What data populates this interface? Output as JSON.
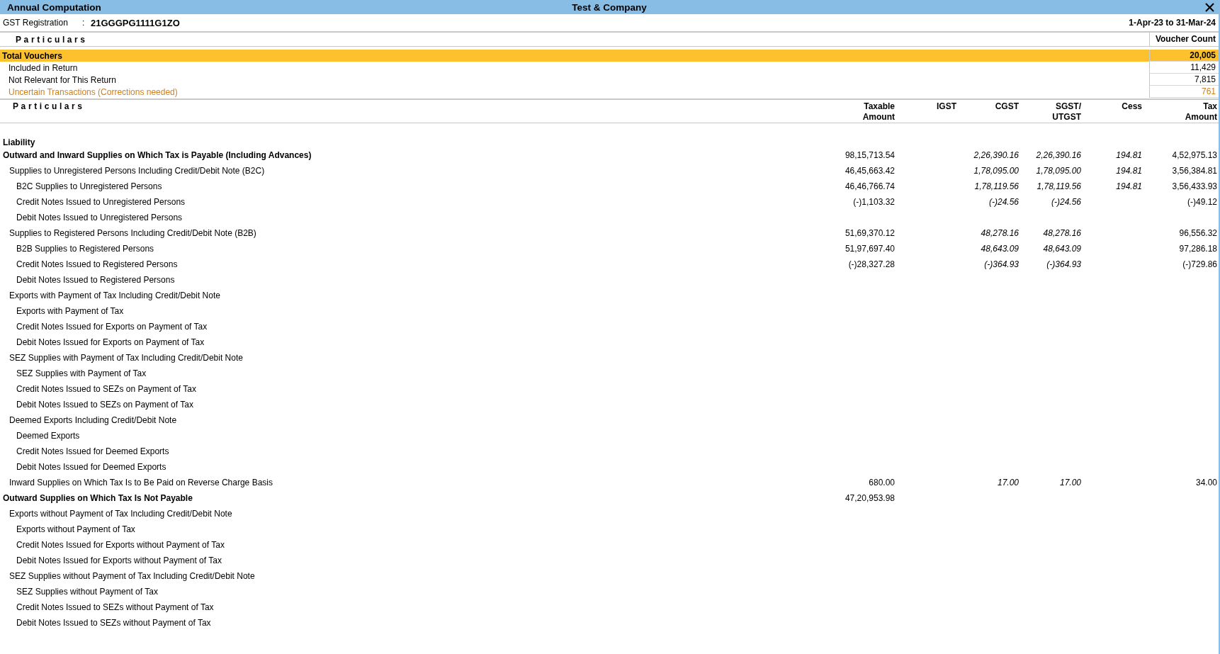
{
  "window": {
    "title": "Annual Computation",
    "company": "Test & Company"
  },
  "registration": {
    "label": "GST Registration",
    "separator": ":",
    "value": "21GGGPG1111G1ZO",
    "period": "1-Apr-23 to 31-Mar-24"
  },
  "voucher_summary": {
    "columns": [
      "Particulars",
      "Voucher Count"
    ],
    "rows": [
      {
        "label": "Total Vouchers",
        "count": "20,005",
        "kind": "total"
      },
      {
        "label": "Included in Return",
        "count": "11,429",
        "kind": "normal"
      },
      {
        "label": "Not Relevant for This Return",
        "count": "7,815",
        "kind": "normal"
      },
      {
        "label": "Uncertain Transactions (Corrections needed)",
        "count": "761",
        "kind": "uncertain"
      }
    ]
  },
  "table": {
    "columns": [
      "Particulars",
      "Taxable Amount",
      "IGST",
      "CGST",
      "SGST/ UTGST",
      "Cess",
      "Tax Amount"
    ],
    "heading": "Liability",
    "rows": [
      {
        "label": "Outward and Inward Supplies on Which Tax is Payable (Including Advances)",
        "taxable": "98,15,713.54",
        "cgst": "2,26,390.16",
        "sgst": "2,26,390.16",
        "cess": "194.81",
        "tax": "4,52,975.13",
        "children": [
          {
            "label": "Supplies to Unregistered Persons Including Credit/Debit Note (B2C)",
            "taxable": "46,45,663.42",
            "cgst": "1,78,095.00",
            "sgst": "1,78,095.00",
            "cess": "194.81",
            "tax": "3,56,384.81",
            "children": [
              {
                "label": "B2C Supplies to Unregistered Persons",
                "taxable": "46,46,766.74",
                "cgst": "1,78,119.56",
                "sgst": "1,78,119.56",
                "cess": "194.81",
                "tax": "3,56,433.93"
              },
              {
                "label": "Credit Notes Issued to Unregistered Persons",
                "taxable": "(-)1,103.32",
                "cgst": "(-)24.56",
                "sgst": "(-)24.56",
                "tax": "(-)49.12"
              },
              {
                "label": "Debit Notes Issued to Unregistered Persons"
              }
            ]
          },
          {
            "label": "Supplies to Registered Persons Including Credit/Debit Note (B2B)",
            "taxable": "51,69,370.12",
            "cgst": "48,278.16",
            "sgst": "48,278.16",
            "tax": "96,556.32",
            "children": [
              {
                "label": "B2B Supplies to Registered Persons",
                "taxable": "51,97,697.40",
                "cgst": "48,643.09",
                "sgst": "48,643.09",
                "tax": "97,286.18"
              },
              {
                "label": "Credit Notes Issued to Registered Persons",
                "taxable": "(-)28,327.28",
                "cgst": "(-)364.93",
                "sgst": "(-)364.93",
                "tax": "(-)729.86"
              },
              {
                "label": "Debit Notes Issued to Registered Persons"
              }
            ]
          },
          {
            "label": "Exports with Payment of Tax Including Credit/Debit Note",
            "children": [
              {
                "label": "Exports with Payment of Tax"
              },
              {
                "label": "Credit Notes Issued for Exports on Payment of Tax"
              },
              {
                "label": "Debit Notes Issued for Exports on Payment of Tax"
              }
            ]
          },
          {
            "label": "SEZ Supplies with Payment of Tax Including Credit/Debit Note",
            "children": [
              {
                "label": "SEZ Supplies with Payment of Tax"
              },
              {
                "label": "Credit Notes Issued to SEZs on Payment of Tax"
              },
              {
                "label": "Debit Notes Issued to SEZs on Payment of Tax"
              }
            ]
          },
          {
            "label": "Deemed Exports Including Credit/Debit Note",
            "children": [
              {
                "label": "Deemed Exports"
              },
              {
                "label": "Credit Notes Issued for Deemed Exports"
              },
              {
                "label": "Debit Notes Issued for Deemed Exports"
              }
            ]
          },
          {
            "label": "Inward Supplies on Which Tax Is to Be Paid on Reverse Charge Basis",
            "taxable": "680.00",
            "cgst": "17.00",
            "sgst": "17.00",
            "tax": "34.00"
          }
        ]
      },
      {
        "label": "Outward Supplies on Which Tax Is Not Payable",
        "taxable": "47,20,953.98",
        "children": [
          {
            "label": "Exports without Payment of Tax Including Credit/Debit Note",
            "children": [
              {
                "label": "Exports without Payment of Tax"
              },
              {
                "label": "Credit Notes Issued for Exports without Payment of Tax"
              },
              {
                "label": "Debit Notes Issued for Exports without Payment of Tax"
              }
            ]
          },
          {
            "label": "SEZ Supplies without Payment of Tax Including Credit/Debit Note",
            "children": [
              {
                "label": "SEZ Supplies without Payment of Tax"
              },
              {
                "label": "Credit Notes Issued to SEZs without Payment of Tax"
              },
              {
                "label": "Debit Notes Issued to SEZs without Payment of Tax"
              }
            ]
          }
        ]
      }
    ]
  }
}
